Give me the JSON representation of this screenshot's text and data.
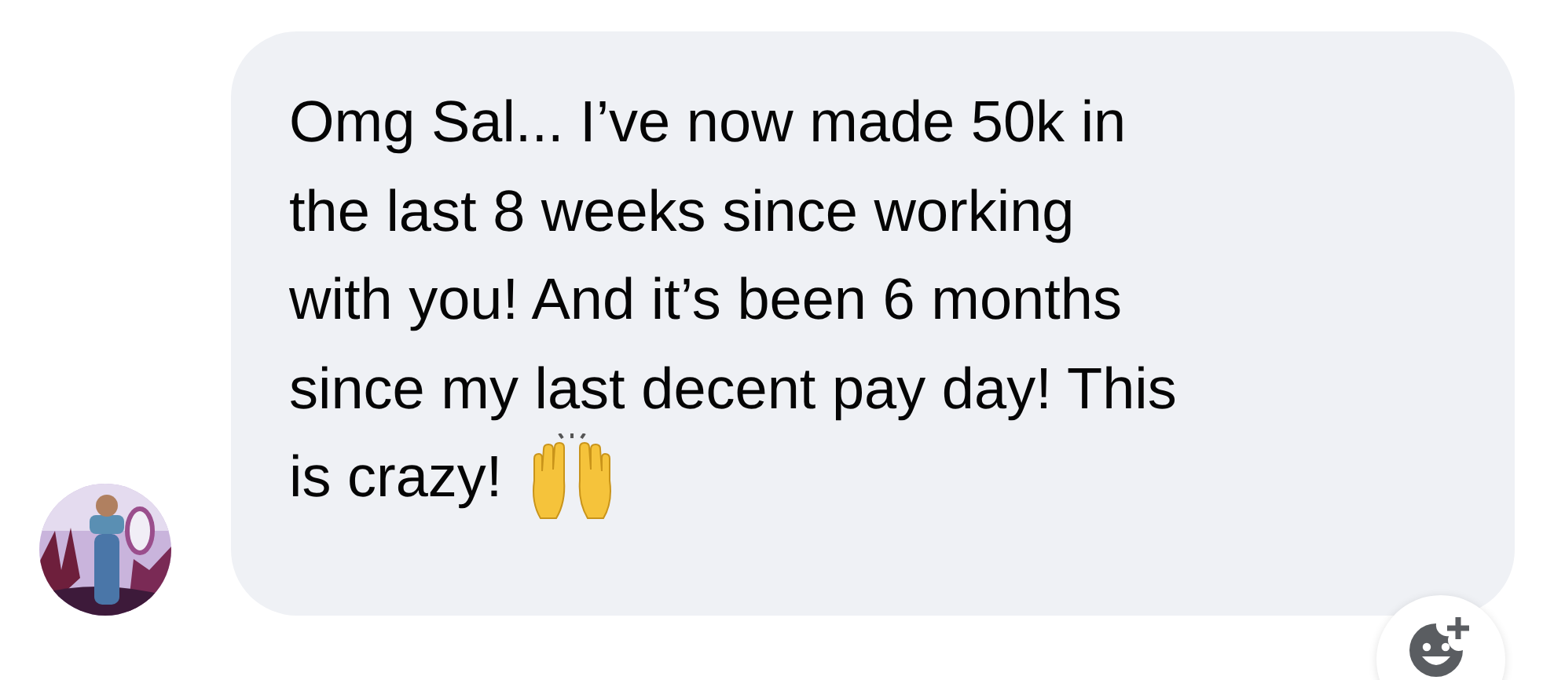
{
  "message": {
    "lines": [
      "Omg Sal... I’ve now made 50k in",
      "the last 8 weeks since working",
      "with you! And it’s been 6 months",
      "since my last decent pay day! This",
      "is crazy!"
    ]
  }
}
